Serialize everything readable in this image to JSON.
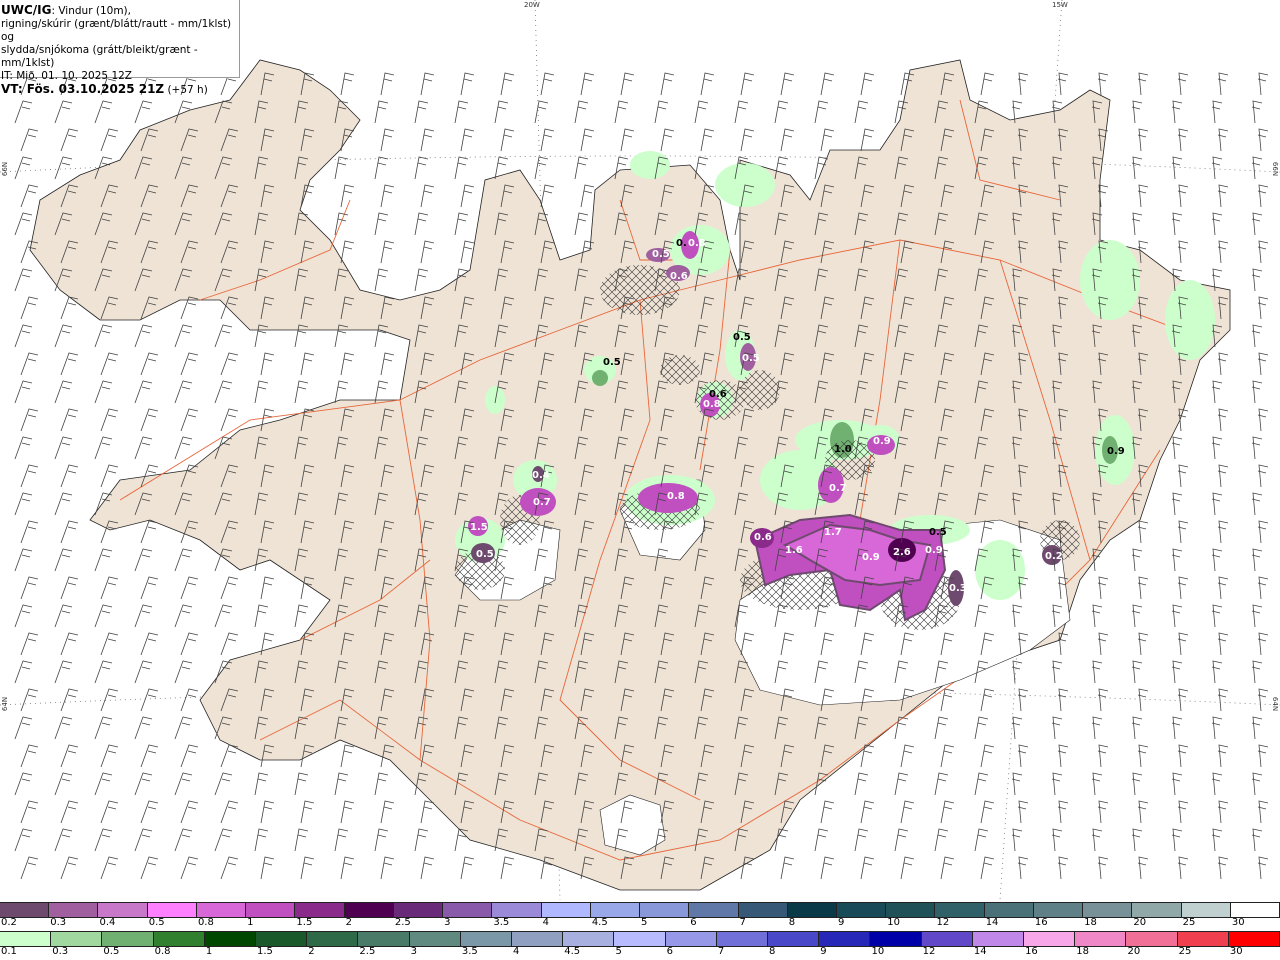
{
  "header": {
    "model": "UWC/IG",
    "title_rest": ": Vindur (10m),",
    "line2": "rigning/skúrir (grænt/blátt/rautt - mm/1klst) og",
    "line3": "slydda/snjókoma (grátt/bleikt/grænt - mm/1klst)",
    "init_time": "IT: Mið. 01. 10. 2025 12Z",
    "valid_label": "VT: Fös. 03.10.2025 21Z",
    "lead": " (+57 h)"
  },
  "grid_labels": {
    "lon_20w": "20W",
    "lon_15w": "15W",
    "lat_66n_left": "66N",
    "lat_64n_left": "64N",
    "lat_66n_right": "66N",
    "lat_64n_right": "64N"
  },
  "colors": {
    "land": "#efe3d5",
    "glacier": "#ffffff",
    "roads": "#e8663a",
    "sea": "#ffffff"
  },
  "precip_labels": [
    {
      "text": "0.5",
      "color": "#000000"
    },
    {
      "text": "0.6",
      "color": "#000000"
    },
    {
      "text": "0.5",
      "color": "#000000"
    },
    {
      "text": "0.5",
      "color": "#ffffff"
    },
    {
      "text": "0.8",
      "color": "#ffffff"
    },
    {
      "text": "0.",
      "color": "#000000"
    },
    {
      "text": "0.8",
      "color": "#ffffff"
    },
    {
      "text": "0.5",
      "color": "#ffffff"
    },
    {
      "text": "0.6",
      "color": "#ffffff"
    },
    {
      "text": "1.0",
      "color": "#000000"
    },
    {
      "text": "0.9",
      "color": "#ffffff"
    },
    {
      "text": "0.7",
      "color": "#ffffff"
    },
    {
      "text": "0.6",
      "color": "#ffffff"
    },
    {
      "text": "1.6",
      "color": "#ffffff"
    },
    {
      "text": "1.7",
      "color": "#ffffff"
    },
    {
      "text": "0.9",
      "color": "#ffffff"
    },
    {
      "text": "2.6",
      "color": "#ffffff"
    },
    {
      "text": "0.9",
      "color": "#ffffff"
    },
    {
      "text": "0.5",
      "color": "#000000"
    },
    {
      "text": "0.3",
      "color": "#ffffff"
    },
    {
      "text": "0.9",
      "color": "#000000"
    },
    {
      "text": "0.8",
      "color": "#ffffff"
    },
    {
      "text": "0.7",
      "color": "#ffffff"
    },
    {
      "text": "0.4",
      "color": "#ffffff"
    },
    {
      "text": "1.5",
      "color": "#ffffff"
    },
    {
      "text": "0.5",
      "color": "#ffffff"
    },
    {
      "text": "0.2",
      "color": "#ffffff"
    }
  ],
  "snow_scale": {
    "labels": [
      "0.2",
      "0.3",
      "0.4",
      "0.5",
      "0.8",
      "1",
      "1.5",
      "2",
      "2.5",
      "3",
      "3.5",
      "4",
      "4.5",
      "5",
      "6",
      "7",
      "8",
      "9",
      "10",
      "12",
      "14",
      "16",
      "18",
      "20",
      "25",
      "30"
    ],
    "colors": [
      "#6e4a6e",
      "#a060a0",
      "#c878c8",
      "#ff80ff",
      "#d868d8",
      "#c050c0",
      "#8a2a8a",
      "#500050",
      "#6a2a7a",
      "#8a5aaa",
      "#9a8ad8",
      "#b0b8ff",
      "#98a8e8",
      "#8898d8",
      "#6078a8",
      "#385878",
      "#0a3a48",
      "#184a58",
      "#205058",
      "#306068",
      "#4a7078",
      "#608088",
      "#789098",
      "#90a8a8",
      "#c0d0d0",
      "#ffffff"
    ]
  },
  "rain_scale": {
    "labels": [
      "0.1",
      "0.3",
      "0.5",
      "0.8",
      "1",
      "1.5",
      "2",
      "2.5",
      "3",
      "3.5",
      "4",
      "4.5",
      "5",
      "6",
      "7",
      "8",
      "9",
      "10",
      "12",
      "14",
      "16",
      "18",
      "20",
      "25",
      "30"
    ],
    "colors": [
      "#ccffcc",
      "#a0d8a0",
      "#70b070",
      "#308030",
      "#004800",
      "#1a5a2a",
      "#2e6a48",
      "#4a7a68",
      "#608a80",
      "#7a98a8",
      "#90a0c0",
      "#a8b0e0",
      "#b8bcff",
      "#9898e8",
      "#7070d8",
      "#4848c8",
      "#2828b8",
      "#0000a8",
      "#6048c8",
      "#c088e8",
      "#f8a8e8",
      "#f088c8",
      "#f07098",
      "#f04050",
      "#ff0000"
    ]
  }
}
